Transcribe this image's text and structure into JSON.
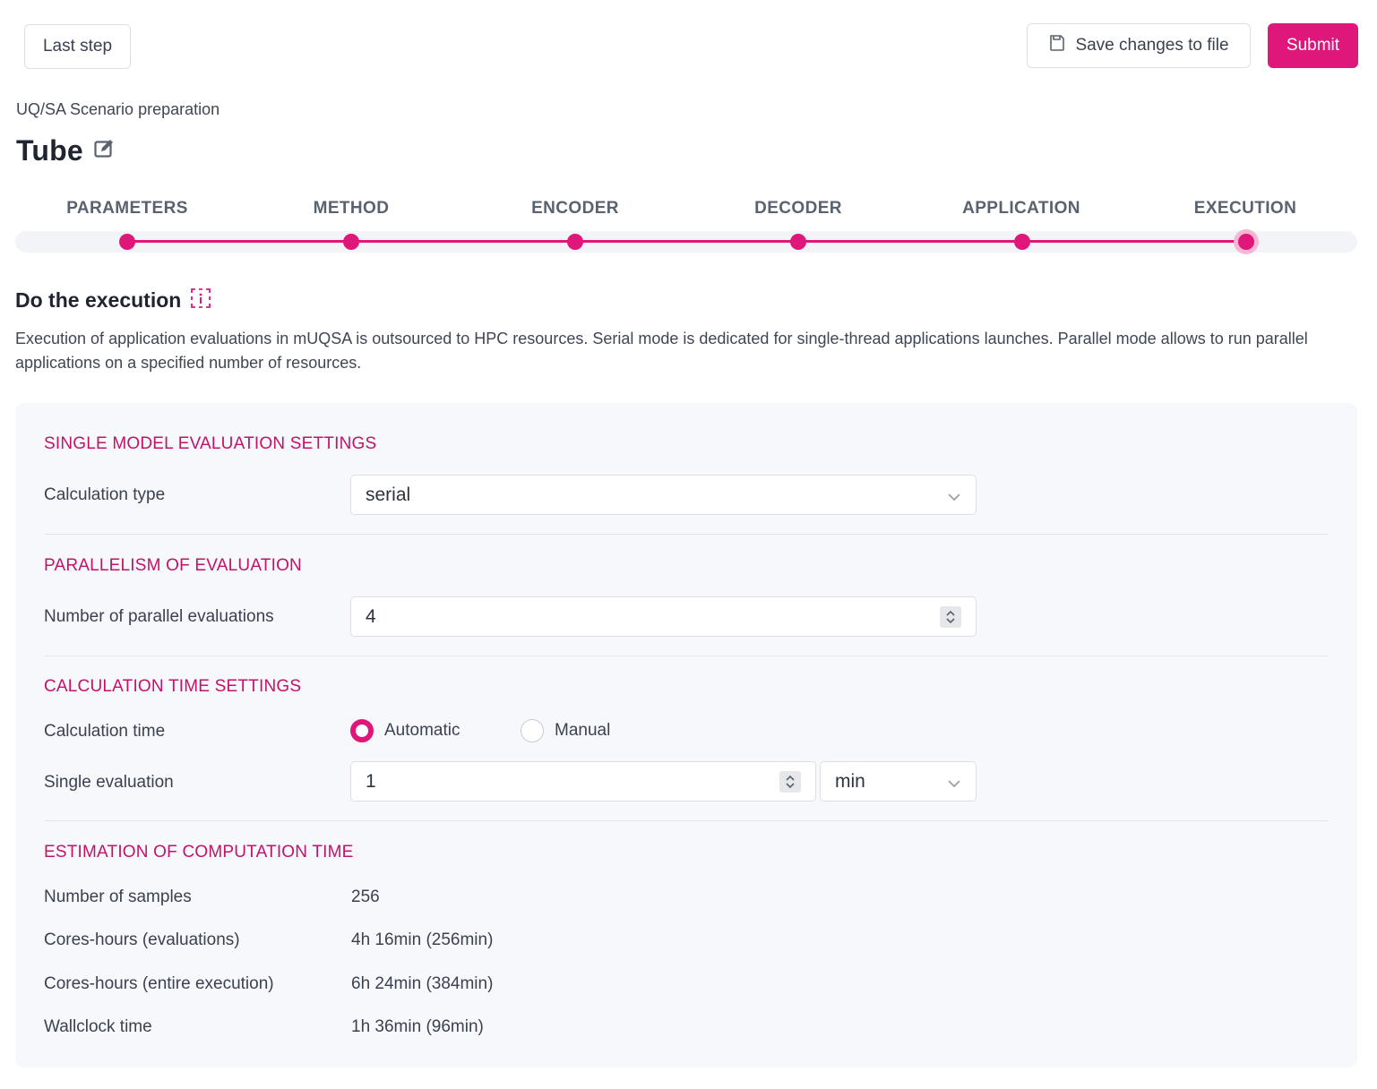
{
  "toolbar": {
    "last_step_label": "Last step",
    "save_label": "Save changes to file",
    "submit_label": "Submit",
    "accent_color": "#e0177b"
  },
  "header": {
    "subtitle": "UQ/SA Scenario preparation",
    "title": "Tube"
  },
  "stepper": {
    "steps": [
      "PARAMETERS",
      "METHOD",
      "ENCODER",
      "DECODER",
      "APPLICATION",
      "EXECUTION"
    ],
    "active_step": "EXECUTION"
  },
  "section": {
    "title": "Do the execution",
    "description": "Execution of application evaluations in mUQSA is outsourced to HPC resources. Serial mode is dedicated for single-thread applications launches. Parallel mode allows to run parallel applications on a specified number of resources."
  },
  "single_model": {
    "title": "SINGLE MODEL EVALUATION SETTINGS",
    "calc_type_label": "Calculation type",
    "calc_type_value": "serial"
  },
  "parallelism": {
    "title": "PARALLELISM OF EVALUATION",
    "label": "Number of parallel evaluations",
    "value": "4"
  },
  "calc_time": {
    "title": "CALCULATION TIME SETTINGS",
    "time_label": "Calculation time",
    "option_automatic": "Automatic",
    "option_manual": "Manual",
    "selected": "Automatic",
    "single_eval_label": "Single evaluation",
    "single_eval_value": "1",
    "unit_value": "min"
  },
  "estimation": {
    "title": "ESTIMATION OF COMPUTATION TIME",
    "rows": [
      {
        "label": "Number of samples",
        "value": "256"
      },
      {
        "label": "Cores-hours (evaluations)",
        "value": "4h 16min (256min)"
      },
      {
        "label": "Cores-hours (entire execution)",
        "value": "6h 24min (384min)"
      },
      {
        "label": "Wallclock time",
        "value": "1h 36min (96min)"
      }
    ]
  }
}
